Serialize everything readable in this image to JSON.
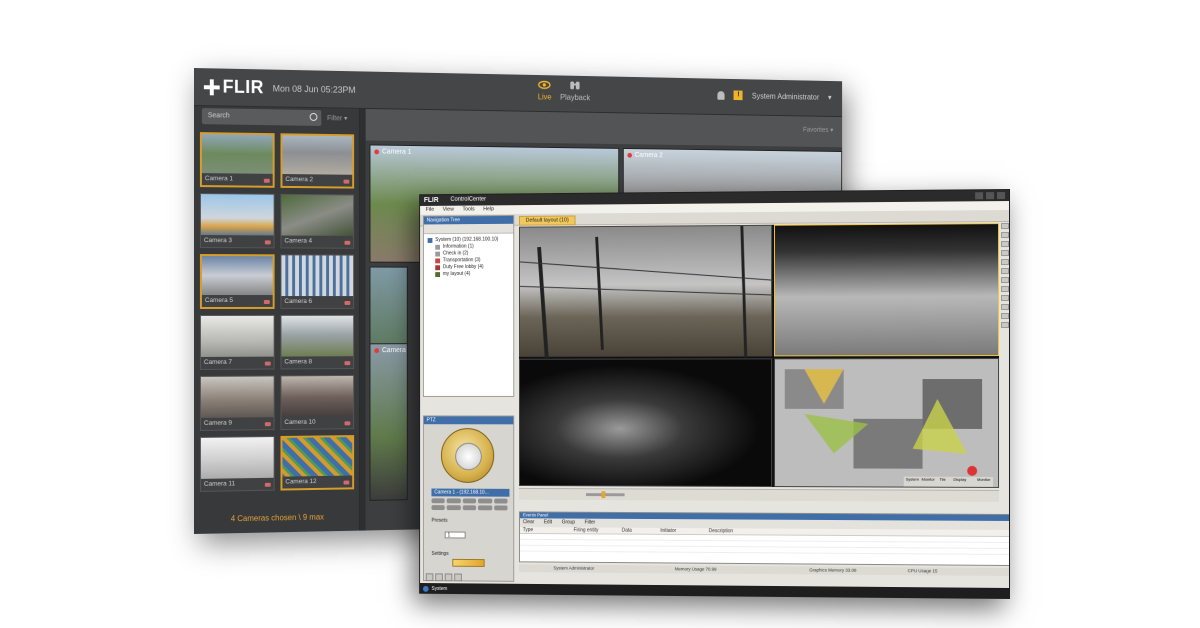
{
  "back": {
    "brand": "FLIR",
    "date": "Mon 08 Jun 05:23PM",
    "nav": [
      {
        "label": "Live",
        "icon": "eye-icon",
        "active": true
      },
      {
        "label": "Playback",
        "icon": "binoculars-icon",
        "active": false
      }
    ],
    "user": "System Administrator",
    "search_placeholder": "Search",
    "filter_label": "Filter",
    "favorites_label": "Favorites",
    "cameras": [
      "Camera 1",
      "Camera 2",
      "Camera 3",
      "Camera 4",
      "Camera 5",
      "Camera 6",
      "Camera 7",
      "Camera 8",
      "Camera 9",
      "Camera 10",
      "Camera 11",
      "Camera 12"
    ],
    "selected_cameras": [
      "Camera 1",
      "Camera 2",
      "Camera 5",
      "Camera 12"
    ],
    "chosen_status": "4 Cameras chosen \\ 9 max",
    "live_tiles": [
      "Camera 1",
      "Camera 2",
      "Camera"
    ],
    "accent": "#f0b429"
  },
  "front": {
    "brand": "FLIR",
    "app_title": "ControlCenter",
    "menu": [
      "File",
      "View",
      "Tools",
      "Help"
    ],
    "layout_tab": "Default layout (10)",
    "nav_title": "Navigation Tree",
    "tree": [
      "System (10) (192.168.100.10)",
      "Information (1)",
      "Check in (2)",
      "Transportation (3)",
      "Duty Free lobby (4)",
      "my layout (4)"
    ],
    "ptz_title": "PTZ",
    "ptz_camera": "Camera 1 - (192.168.10...",
    "presets_label": "Presets",
    "preset_value": "1",
    "settings_label": "Settings",
    "monitor_labels": [
      "System",
      "Monitor",
      "Tile",
      "Display"
    ],
    "monitor_title": "Monitor",
    "events": {
      "title": "Events Panel",
      "toolbar": [
        "Clear",
        "Edit",
        "Group",
        "Filter"
      ],
      "columns": [
        "Type",
        "Firing entity",
        "Data",
        "Initiator",
        "Description"
      ]
    },
    "status": {
      "memory": "Memory Usage  70.99",
      "graphics": "Graphics Memory  33.09",
      "cpu": "CPU Usage  15",
      "user": "System Administrator"
    },
    "taskbar": "System",
    "accent": "#3f6ea8"
  }
}
